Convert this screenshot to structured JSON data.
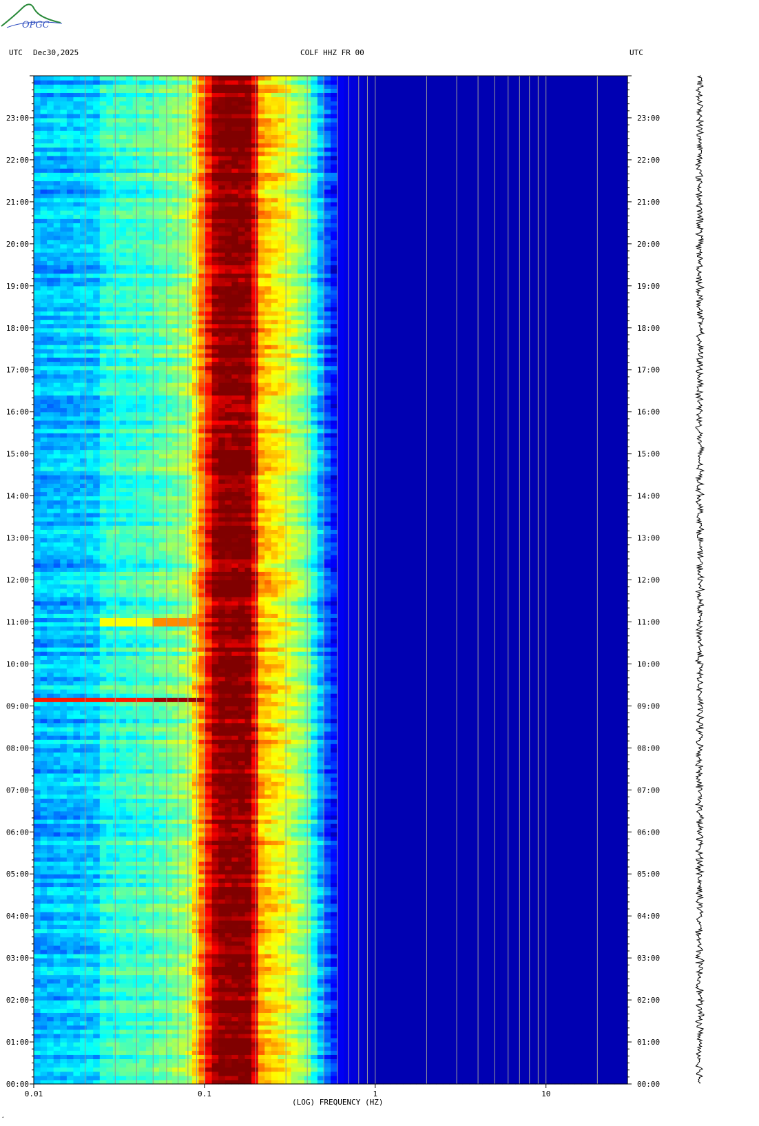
{
  "logo": {
    "text": "OPGC",
    "color": "#2a8a3a",
    "text_color": "#3050c0"
  },
  "header": {
    "left_tz": "UTC",
    "date": "Dec30,2025",
    "station": "COLF HHZ FR 00",
    "right_tz": "UTC"
  },
  "footer_mark": "ˆ",
  "chart_data": {
    "type": "heatmap",
    "title": "COLF HHZ FR 00",
    "xlabel": "(LOG) FREQUENCY (HZ)",
    "ylabel": "",
    "x_scale": "log",
    "xlim": [
      0.01,
      30
    ],
    "x_tick_labels": [
      "0.01",
      "0.1",
      "1",
      "10"
    ],
    "x_tick_values": [
      0.01,
      0.1,
      1,
      10
    ],
    "x_gridlines_hz": [
      0.02,
      0.03,
      0.04,
      0.05,
      0.06,
      0.07,
      0.08,
      0.09,
      0.1,
      0.2,
      0.3,
      0.4,
      0.5,
      0.6,
      0.7,
      0.8,
      0.9,
      1,
      2,
      3,
      4,
      5,
      6,
      7,
      8,
      9,
      10,
      20
    ],
    "y_unit": "hour UTC",
    "ylim": [
      0,
      24
    ],
    "y_tick_labels": [
      "00:00",
      "01:00",
      "02:00",
      "03:00",
      "04:00",
      "05:00",
      "06:00",
      "07:00",
      "08:00",
      "09:00",
      "10:00",
      "11:00",
      "12:00",
      "13:00",
      "14:00",
      "15:00",
      "16:00",
      "17:00",
      "18:00",
      "19:00",
      "20:00",
      "21:00",
      "22:00",
      "23:00"
    ],
    "y_tick_values": [
      0,
      1,
      2,
      3,
      4,
      5,
      6,
      7,
      8,
      9,
      10,
      11,
      12,
      13,
      14,
      15,
      16,
      17,
      18,
      19,
      20,
      21,
      22,
      23
    ],
    "colormap": [
      "#00007f",
      "#0000ff",
      "#0080ff",
      "#00ffff",
      "#80ff80",
      "#ffff00",
      "#ff8000",
      "#ff0000",
      "#800000"
    ],
    "spectral_profile": [
      {
        "f_hz": 0.01,
        "level": 0.3
      },
      {
        "f_hz": 0.024,
        "level": 0.33
      },
      {
        "f_hz": 0.025,
        "level": 0.4
      },
      {
        "f_hz": 0.05,
        "level": 0.44
      },
      {
        "f_hz": 0.08,
        "level": 0.52
      },
      {
        "f_hz": 0.1,
        "level": 0.8
      },
      {
        "f_hz": 0.12,
        "level": 1.0
      },
      {
        "f_hz": 0.19,
        "level": 1.0
      },
      {
        "f_hz": 0.21,
        "level": 0.7
      },
      {
        "f_hz": 0.3,
        "level": 0.6
      },
      {
        "f_hz": 0.4,
        "level": 0.48
      },
      {
        "f_hz": 0.5,
        "level": 0.25
      },
      {
        "f_hz": 0.6,
        "level": 0.12
      },
      {
        "f_hz": 1.0,
        "level": 0.05
      },
      {
        "f_hz": 30,
        "level": 0.05
      }
    ],
    "events": [
      {
        "hour": 9.15,
        "f_min_hz": 0.01,
        "f_max_hz": 0.1,
        "level": 0.85
      },
      {
        "hour": 11.0,
        "f_min_hz": 0.025,
        "f_max_hz": 0.1,
        "level": 0.62
      }
    ],
    "grid": true,
    "side_trace": "seismogram"
  }
}
